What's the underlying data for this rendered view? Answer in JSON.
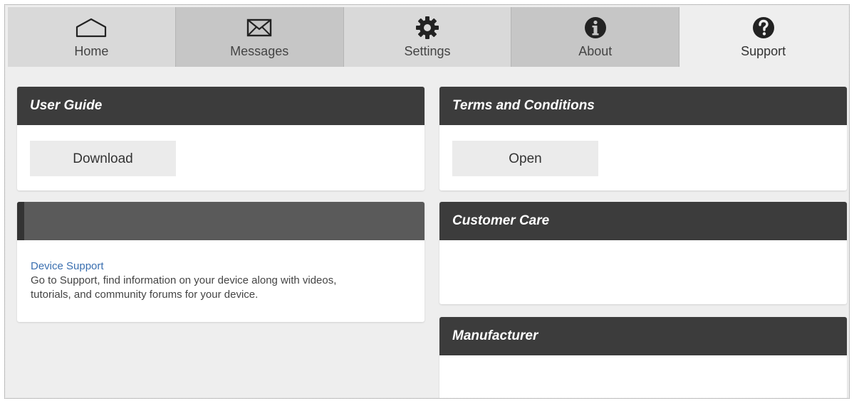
{
  "tabs": [
    {
      "label": "Home",
      "icon": "home-icon"
    },
    {
      "label": "Messages",
      "icon": "envelope-icon"
    },
    {
      "label": "Settings",
      "icon": "gear-icon"
    },
    {
      "label": "About",
      "icon": "info-icon"
    },
    {
      "label": "Support",
      "icon": "question-icon",
      "active": true
    }
  ],
  "user_guide": {
    "title": "User Guide",
    "button": "Download"
  },
  "terms": {
    "title": "Terms and Conditions",
    "button": "Open"
  },
  "device_support": {
    "title": "",
    "link": "Device Support",
    "description_line1": "Go to Support, find information on your device along with videos,",
    "description_line2": "tutorials, and community forums for your device."
  },
  "customer_care": {
    "title": "Customer Care"
  },
  "manufacturer": {
    "title": "Manufacturer"
  },
  "colors": {
    "header_bg": "#3c3c3c",
    "link": "#3a6fb0",
    "page_bg": "#eeeeee"
  }
}
